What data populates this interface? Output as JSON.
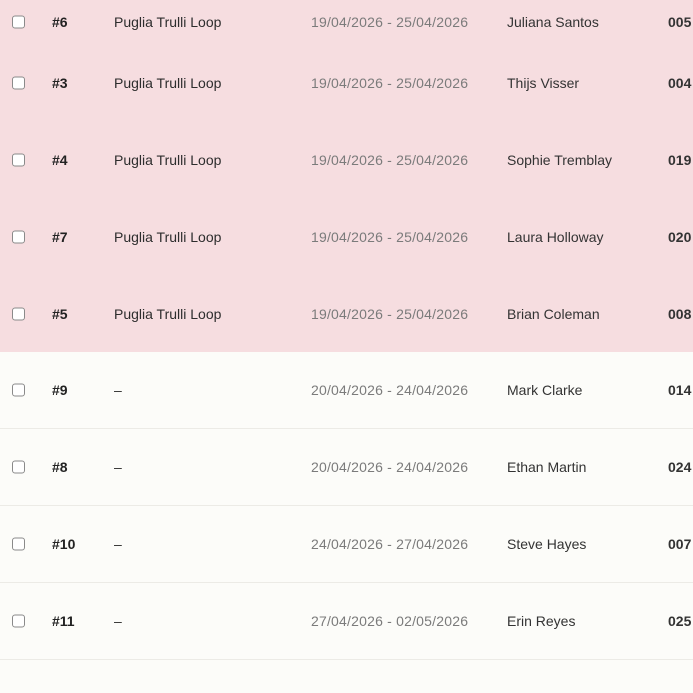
{
  "bookings": [
    {
      "id": "#6",
      "trip": "Puglia Trulli Loop",
      "dates": "19/04/2026 - 25/04/2026",
      "guest": "Juliana Santos",
      "code": "005",
      "highlighted": true
    },
    {
      "id": "#3",
      "trip": "Puglia Trulli Loop",
      "dates": "19/04/2026 - 25/04/2026",
      "guest": "Thijs Visser",
      "code": "004",
      "highlighted": true
    },
    {
      "id": "#4",
      "trip": "Puglia Trulli Loop",
      "dates": "19/04/2026 - 25/04/2026",
      "guest": "Sophie Tremblay",
      "code": "019",
      "highlighted": true
    },
    {
      "id": "#7",
      "trip": "Puglia Trulli Loop",
      "dates": "19/04/2026 - 25/04/2026",
      "guest": "Laura Holloway",
      "code": "020",
      "highlighted": true
    },
    {
      "id": "#5",
      "trip": "Puglia Trulli Loop",
      "dates": "19/04/2026 - 25/04/2026",
      "guest": "Brian Coleman",
      "code": "008",
      "highlighted": true
    },
    {
      "id": "#9",
      "trip": "–",
      "dates": "20/04/2026 - 24/04/2026",
      "guest": "Mark Clarke",
      "code": "014",
      "highlighted": false
    },
    {
      "id": "#8",
      "trip": "–",
      "dates": "20/04/2026 - 24/04/2026",
      "guest": "Ethan Martin",
      "code": "024",
      "highlighted": false
    },
    {
      "id": "#10",
      "trip": "–",
      "dates": "24/04/2026 - 27/04/2026",
      "guest": "Steve Hayes",
      "code": "007",
      "highlighted": false
    },
    {
      "id": "#11",
      "trip": "–",
      "dates": "27/04/2026 - 02/05/2026",
      "guest": "Erin Reyes",
      "code": "025",
      "highlighted": false
    }
  ],
  "colors": {
    "highlight_row": "#f6dde0",
    "background": "#fcfcf9",
    "date_text": "#7b7b7b"
  }
}
